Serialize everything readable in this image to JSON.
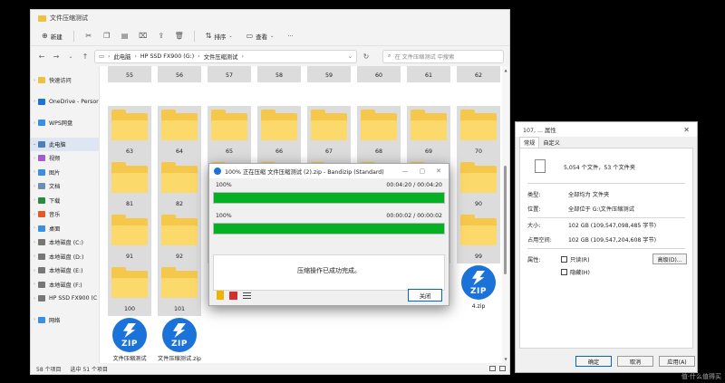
{
  "explorer": {
    "title": "文件压缩测试",
    "toolbar": {
      "new": "新建",
      "sort": "排序",
      "view": "查看",
      "more": "···"
    },
    "path": [
      "此电脑",
      "HP SSD FX900 (G:)",
      "文件压缩测试"
    ],
    "search_placeholder": "在 文件压缩测试 中搜索",
    "sidebar": [
      {
        "label": "快速访问",
        "color": "#f0c040",
        "chev": "›"
      },
      {
        "gap": true
      },
      {
        "label": "OneDrive - Persor",
        "color": "#1b73d9",
        "chev": "›"
      },
      {
        "gap": true
      },
      {
        "label": "WPS网盘",
        "color": "#3a8fe0",
        "chev": "›"
      },
      {
        "gap": true
      },
      {
        "label": "此电脑",
        "color": "#4a7fb8",
        "chev": "⌄",
        "active": true
      },
      {
        "label": "视频",
        "color": "#a05cd0",
        "chev": "›"
      },
      {
        "label": "图片",
        "color": "#3a8fe0",
        "chev": "›"
      },
      {
        "label": "文档",
        "color": "#6b8fb8",
        "chev": "›"
      },
      {
        "label": "下载",
        "color": "#2a8a40",
        "chev": "›"
      },
      {
        "label": "音乐",
        "color": "#e05a2a",
        "chev": "›"
      },
      {
        "label": "桌面",
        "color": "#3a8fe0",
        "chev": "›"
      },
      {
        "label": "本地磁盘 (C:)",
        "color": "#777777",
        "chev": "›"
      },
      {
        "label": "本地磁盘 (D:)",
        "color": "#777777",
        "chev": "›"
      },
      {
        "label": "本地磁盘 (E:)",
        "color": "#777777",
        "chev": "›"
      },
      {
        "label": "本地磁盘 (F:)",
        "color": "#777777",
        "chev": "›"
      },
      {
        "label": "HP SSD FX900 (C",
        "color": "#777777",
        "chev": "›"
      },
      {
        "gap": true
      },
      {
        "label": "网络",
        "color": "#3a8fe0",
        "chev": "›"
      }
    ],
    "top_row": [
      "55",
      "56",
      "57",
      "58",
      "59",
      "60",
      "61",
      "62"
    ],
    "rows": [
      [
        "63",
        "64",
        "65",
        "66",
        "67",
        "68",
        "69",
        "70"
      ],
      [
        "81",
        "82",
        "",
        "",
        "",
        "",
        "",
        "90"
      ],
      [
        "91",
        "92",
        "",
        "",
        "",
        "",
        "",
        "99"
      ],
      [
        "100",
        "101"
      ]
    ],
    "zips": [
      {
        "name": "文件压缩测试 (2).zip",
        "icon": "ZIP"
      },
      {
        "name": "文件压缩测试.zip",
        "icon": "ZIP"
      },
      {
        "name": "4.zip",
        "icon": "ZIP"
      }
    ],
    "status": {
      "items": "58 个项目",
      "selected": "选中 51 个项目"
    }
  },
  "bandizip": {
    "title": "100% 正在压缩 文件压缩测试 (2).zip - Bandizip (Standard)",
    "progress1": {
      "percent": "100%",
      "time": "00:04:20 / 00:04:20",
      "fraction": 1.0
    },
    "progress2": {
      "percent": "100%",
      "time": "00:00:02 / 00:00:02",
      "fraction": 1.0
    },
    "message": "压缩操作已成功完成。",
    "close_label": "关闭"
  },
  "props": {
    "title": "107, ... 属性",
    "tabs": [
      "常规",
      "自定义"
    ],
    "summary": "5,054 个文件，53 个文件夹",
    "rows": [
      {
        "k": "类型:",
        "v": "全部均为 文件夹"
      },
      {
        "k": "位置:",
        "v": "全部位于 G:\\文件压缩测试"
      },
      {
        "k": "大小:",
        "v": "102 GB (109,547,098,485 字节)"
      },
      {
        "k": "占用空间:",
        "v": "102 GB (109,547,204,608 字节)"
      }
    ],
    "attr_label": "属性:",
    "readonly": "只读(R)",
    "hidden": "隐藏(H)",
    "advanced": "高级(D)...",
    "ok": "确定",
    "cancel": "取消",
    "apply": "应用(A)"
  },
  "watermark": "值·什么值得买"
}
